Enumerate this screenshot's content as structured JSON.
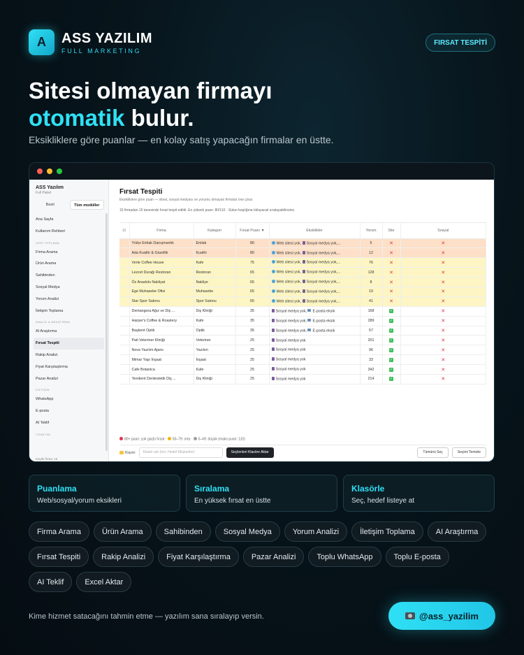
{
  "brand": {
    "logo_letter": "A",
    "name": "ASS YAZILIM",
    "tagline": "FULL MARKETING",
    "accent_color": "#2fe0f5"
  },
  "top_badge": "FIRSAT TESPİTİ",
  "headline": {
    "line1": "Sitesi olmayan firmayı",
    "accent": "otomatik",
    "rest": " bulur."
  },
  "subline": "Eksikliklere göre puanlar — en kolay satış yapacağın firmalar en üstte.",
  "app": {
    "sidebar": {
      "title": "ASS Yazılım",
      "subtitle": "Full Paket",
      "modes": [
        "Basit",
        "Tüm modüller"
      ],
      "top_items": [
        "Ana Sayfa",
        "Kullanım Rehberi"
      ],
      "section1": "VERİ TOPLAMA",
      "group1": [
        "Firma Arama",
        "Ürün Arama",
        "Sahibinden",
        "Sosyal Medya",
        "Yorum Analizi",
        "İletişim Toplama"
      ],
      "section2": "ANALİZ & ARAŞTIRMA",
      "group2": [
        "AI Araştırma",
        "Fırsat Tespiti",
        "Rakip Analizi",
        "Fiyat Karşılaştırma",
        "Pazar Analizi"
      ],
      "section3": "İLETİŞİM",
      "group3": [
        "WhatsApp",
        "E-posta",
        "AI Teklif"
      ],
      "section4": "YÖNETİM",
      "footer": "Kayıtlı firma: 15"
    },
    "main": {
      "title": "Fırsat Tespiti",
      "description": "Eksikliklere göre puan — sitesi, sosyal medyası ve yorumu olmayan firmalar öne çıkar.",
      "stats": "15 firmadan 15 tanesinde fırsat tespit edildi.  En yüksek puan: 80/110  ·  Sütun başlığına tıklayarak sıralayabilirsiniz.",
      "columns": [
        "☑",
        "Firma",
        "Kategori",
        "Fırsat Puanı ▼",
        "Eksiklikler",
        "Yorum",
        "Site",
        "Sosyal"
      ],
      "rows": [
        {
          "tier": "orange",
          "firma": "Yıldız Emlak Danışmanlık",
          "kategori": "Emlak",
          "puan": "80",
          "eksik": [
            "web",
            "Web sitesi yok,",
            "sosyal",
            "Sosyal medya yok,..."
          ],
          "yorum": "5",
          "site": "x",
          "sosyal": "x"
        },
        {
          "tier": "orange",
          "firma": "Ada Kuaför & Güzellik",
          "kategori": "Kuaför",
          "puan": "80",
          "eksik": [
            "web",
            "Web sitesi yok,",
            "sosyal",
            "Sosyal medya yok,..."
          ],
          "yorum": "12",
          "site": "x",
          "sosyal": "x"
        },
        {
          "tier": "yellow",
          "firma": "Verte Coffee House",
          "kategori": "Kafe",
          "puan": "75",
          "eksik": [
            "web",
            "Web sitesi yok,",
            "sosyal",
            "Sosyal medya yok,..."
          ],
          "yorum": "76",
          "site": "x",
          "sosyal": "x"
        },
        {
          "tier": "yellow",
          "firma": "Lezzet Durağı Restoran",
          "kategori": "Restoran",
          "puan": "65",
          "eksik": [
            "web",
            "Web sitesi yok,",
            "sosyal",
            "Sosyal medya yok,..."
          ],
          "yorum": "128",
          "site": "x",
          "sosyal": "x"
        },
        {
          "tier": "yellow",
          "firma": "Öz Anadolu Nakliyat",
          "kategori": "Nakliye",
          "puan": "65",
          "eksik": [
            "web",
            "Web sitesi yok,",
            "sosyal",
            "Sosyal medya yok,..."
          ],
          "yorum": "8",
          "site": "x",
          "sosyal": "x"
        },
        {
          "tier": "yellow",
          "firma": "Ege Muhasebe Ofisi",
          "kategori": "Muhasebe",
          "puan": "65",
          "eksik": [
            "web",
            "Web sitesi yok,",
            "sosyal",
            "Sosyal medya yok,..."
          ],
          "yorum": "19",
          "site": "x",
          "sosyal": "x"
        },
        {
          "tier": "yellow",
          "firma": "Star Spor Salonu",
          "kategori": "Spor Salonu",
          "puan": "65",
          "eksik": [
            "web",
            "Web sitesi yok,",
            "sosyal",
            "Sosyal medya yok,..."
          ],
          "yorum": "41",
          "site": "x",
          "sosyal": "x"
        },
        {
          "tier": "white",
          "firma": "Dentangora Ağız ve Diş ...",
          "kategori": "Diş Kliniği",
          "puan": "35",
          "eksik": [
            "sosyal",
            "Sosyal medya yok,",
            "email",
            "E-posta eksik"
          ],
          "yorum": "168",
          "site": "ok",
          "sosyal": "x"
        },
        {
          "tier": "white",
          "firma": "Harper's Coffee & Roastery",
          "kategori": "Kafe",
          "puan": "35",
          "eksik": [
            "sosyal",
            "Sosyal medya yok,",
            "email",
            "E-posta eksik"
          ],
          "yorum": "289",
          "site": "ok",
          "sosyal": "x"
        },
        {
          "tier": "white",
          "firma": "Başkent Optik",
          "kategori": "Optik",
          "puan": "35",
          "eksik": [
            "sosyal",
            "Sosyal medya yok,",
            "email",
            "E-posta eksik"
          ],
          "yorum": "57",
          "site": "ok",
          "sosyal": "x"
        },
        {
          "tier": "white",
          "firma": "Pati Veteriner Kliniği",
          "kategori": "Veteriner",
          "puan": "25",
          "eksik": [
            "sosyal",
            "Sosyal medya yok",
            "",
            ""
          ],
          "yorum": "201",
          "site": "ok",
          "sosyal": "x"
        },
        {
          "tier": "white",
          "firma": "Nova Yazılım Ajans",
          "kategori": "Yazılım",
          "puan": "25",
          "eksik": [
            "sosyal",
            "Sosyal medya yok",
            "",
            ""
          ],
          "yorum": "96",
          "site": "ok",
          "sosyal": "x"
        },
        {
          "tier": "white",
          "firma": "Mimar Yapı İnşaat",
          "kategori": "İnşaat",
          "puan": "25",
          "eksik": [
            "sosyal",
            "Sosyal medya yok",
            "",
            ""
          ],
          "yorum": "33",
          "site": "ok",
          "sosyal": "x"
        },
        {
          "tier": "white",
          "firma": "Cafe Botanica",
          "kategori": "Kafe",
          "puan": "25",
          "eksik": [
            "sosyal",
            "Sosyal medya yok",
            "",
            ""
          ],
          "yorum": "342",
          "site": "ok",
          "sosyal": "x"
        },
        {
          "tier": "white",
          "firma": "Yenikent Dentestetik Diş ...",
          "kategori": "Diş Kliniği",
          "puan": "25",
          "eksik": [
            "sosyal",
            "Sosyal medya yok",
            "",
            ""
          ],
          "yorum": "214",
          "site": "ok",
          "sosyal": "x"
        }
      ],
      "legend": [
        "80+ puan: çok güçlü fırsat",
        "50–79: orta",
        "0–49: düşük  (maks puan: 110)"
      ],
      "legend_colors": [
        "#e0344a",
        "#f4b400",
        "#9aa0a6"
      ],
      "bottom": {
        "folder_label": "Klasör:",
        "folder_placeholder": "Klasör adı  (örn. Hedef Müşteriler)",
        "move_button": "Seçilenleri Klasöre Aktar",
        "select_all": "Tümünü Seç",
        "clear": "Seçimi Temizle"
      }
    }
  },
  "cards": [
    {
      "title": "Puanlama",
      "desc": "Web/sosyal/yorum eksikleri"
    },
    {
      "title": "Sıralama",
      "desc": "En yüksek fırsat en üstte"
    },
    {
      "title": "Klasörle",
      "desc": "Seç, hedef listeye at"
    }
  ],
  "chips": [
    "Firma Arama",
    "Ürün Arama",
    "Sahibinden",
    "Sosyal Medya",
    "Yorum Analizi",
    "İletişim Toplama",
    "AI Araştırma",
    "Fırsat Tespiti",
    "Rakip Analizi",
    "Fiyat Karşılaştırma",
    "Pazar Analizi",
    "Toplu WhatsApp",
    "Toplu E-posta",
    "AI Teklif",
    "Excel Aktar"
  ],
  "footer_text": "Kime hizmet satacağını tahmin etme — yazılım sana sıralayıp versin.",
  "cta": {
    "icon": "camera-icon",
    "label": "@ass_yazilim"
  }
}
